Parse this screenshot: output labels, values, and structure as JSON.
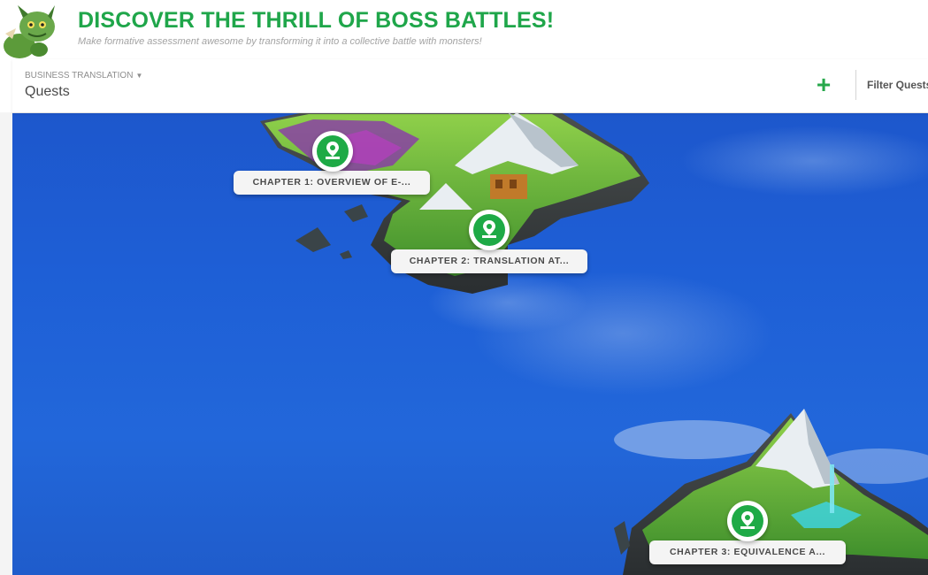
{
  "banner": {
    "title": "DISCOVER THE THRILL OF BOSS BATTLES!",
    "subtitle": "Make formative assessment awesome by transforming it into a collective battle with monsters!",
    "mascot_icon": "monster-mascot-icon"
  },
  "header": {
    "course_name": "BUSINESS TRANSLATION",
    "page_title": "Quests",
    "add_icon": "plus-icon",
    "filter_placeholder": "Filter Quests"
  },
  "quests": [
    {
      "label": "CHAPTER 1: OVERVIEW OF E-...",
      "icon": "map-pin-icon"
    },
    {
      "label": "CHAPTER 2: TRANSLATION AT...",
      "icon": "map-pin-icon"
    },
    {
      "label": "CHAPTER 3: EQUIVALENCE A...",
      "icon": "map-pin-icon"
    }
  ],
  "colors": {
    "accent_green": "#1fa64a",
    "ocean_blue": "#1e5fd6",
    "label_bg": "#f4f4f4"
  }
}
